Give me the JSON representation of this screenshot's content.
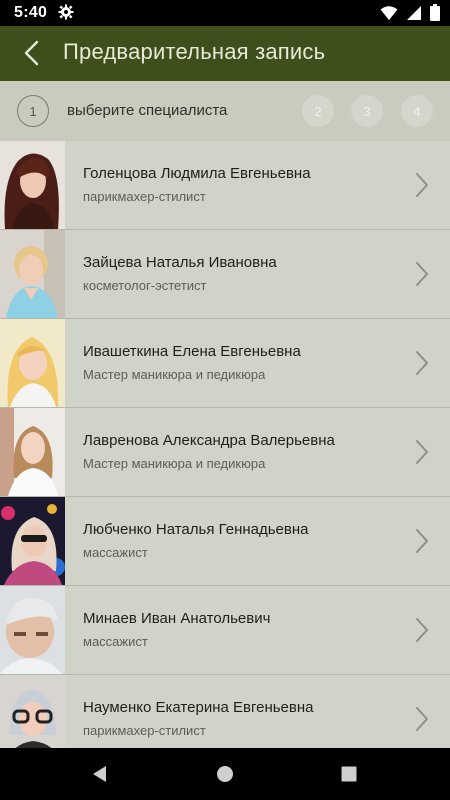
{
  "status_bar": {
    "time": "5:40",
    "icons": [
      "gear-icon",
      "wifi-icon",
      "signal-icon",
      "battery-icon"
    ]
  },
  "app_bar": {
    "title": "Предварительная запись",
    "back_icon": "back-arrow-icon",
    "background": "#3f4f1b"
  },
  "steps": {
    "current": "1",
    "current_label": "выберите специалиста",
    "others": [
      "2",
      "3",
      "4"
    ]
  },
  "specialists": [
    {
      "name": "Голенцова Людмила Евгеньевна",
      "role": "парикмахер-стилист"
    },
    {
      "name": "Зайцева Наталья Ивановна",
      "role": "косметолог-эстетист"
    },
    {
      "name": "Ивашеткина Елена Евгеньевна",
      "role": "Мастер маникюра и педикюра"
    },
    {
      "name": "Лавренова Александра Валерьевна",
      "role": "Мастер маникюра и педикюра"
    },
    {
      "name": "Любченко Наталья Геннадьевна",
      "role": "массажист"
    },
    {
      "name": "Минаев Иван Анатольевич",
      "role": "массажист"
    },
    {
      "name": "Науменко Екатерина Евгеньевна",
      "role": "парикмахер-стилист"
    }
  ],
  "nav_bar": {
    "icons": [
      "back-triangle-icon",
      "home-circle-icon",
      "recents-square-icon"
    ]
  }
}
